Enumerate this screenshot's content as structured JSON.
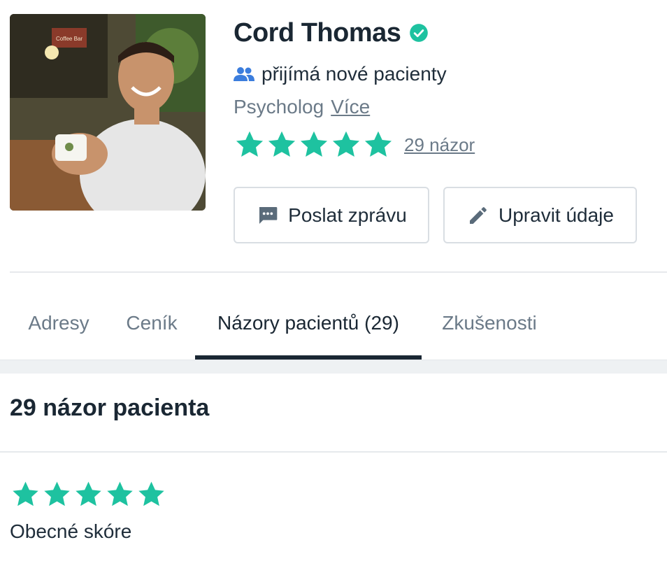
{
  "profile": {
    "name": "Cord Thomas",
    "accepting_text": "přijímá nové pacienty",
    "specialty": "Psycholog",
    "more_link": "Více",
    "rating_stars": 5,
    "reviews_link": "29 názor",
    "photo_sign": "Coffee Bar",
    "icons": {
      "verified": "verified-check-icon",
      "accepting": "people-icon",
      "star": "star-icon"
    }
  },
  "actions": {
    "message_label": "Poslat zprávu",
    "edit_label": "Upravit údaje",
    "message_icon": "chat-bubble-icon",
    "edit_icon": "pencil-icon"
  },
  "tabs": [
    {
      "label": "Adresy",
      "active": false
    },
    {
      "label": "Ceník",
      "active": false
    },
    {
      "label": "Názory pacientů (29)",
      "active": true
    },
    {
      "label": "Zkušenosti",
      "active": false
    }
  ],
  "reviews_section": {
    "title": "29 názor pacienta",
    "overall_stars": 5,
    "overall_label": "Obecné skóre"
  },
  "colors": {
    "accent_green": "#1ec2a0",
    "accent_blue": "#3b7ddd",
    "text_dark": "#1a2733",
    "text_muted": "#6b7a88"
  }
}
